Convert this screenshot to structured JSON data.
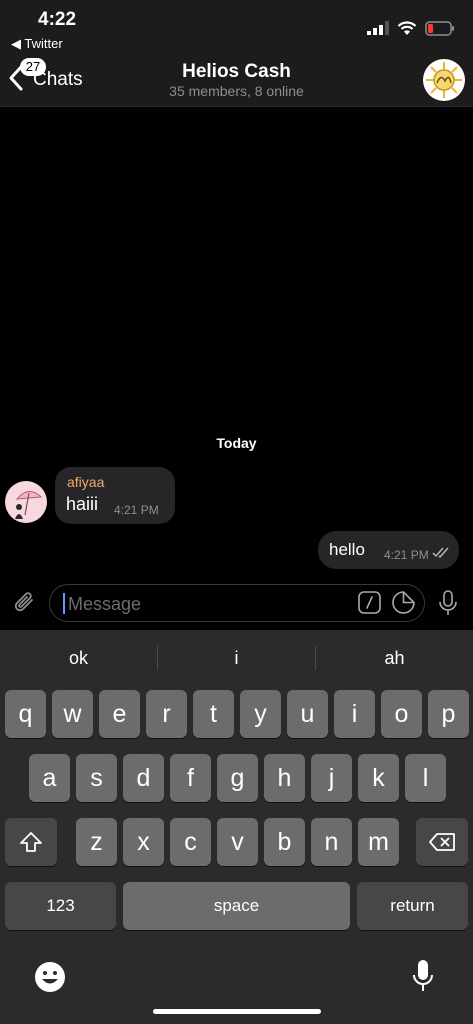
{
  "status": {
    "time": "4:22",
    "back_app": "◀ Twitter"
  },
  "nav": {
    "badge": "27",
    "back_label": "Chats",
    "title": "Helios Cash",
    "subtitle": "35 members, 8 online"
  },
  "chat": {
    "date": "Today",
    "incoming": {
      "sender": "afiyaa",
      "text": "haiii",
      "time": "4:21 PM"
    },
    "outgoing": {
      "text": "hello",
      "time": "4:21 PM"
    }
  },
  "composer": {
    "placeholder": "Message"
  },
  "suggestions": [
    "ok",
    "i",
    "ah"
  ],
  "keys": {
    "row1": [
      "q",
      "w",
      "e",
      "r",
      "t",
      "y",
      "u",
      "i",
      "o",
      "p"
    ],
    "row2": [
      "a",
      "s",
      "d",
      "f",
      "g",
      "h",
      "j",
      "k",
      "l"
    ],
    "row3": [
      "z",
      "x",
      "c",
      "v",
      "b",
      "n",
      "m"
    ],
    "numbers": "123",
    "space": "space",
    "return": "return"
  },
  "colors": {
    "sender_name": "#f2a967",
    "accent_caret": "#5e9cff",
    "battery_low": "#ff3b30"
  }
}
